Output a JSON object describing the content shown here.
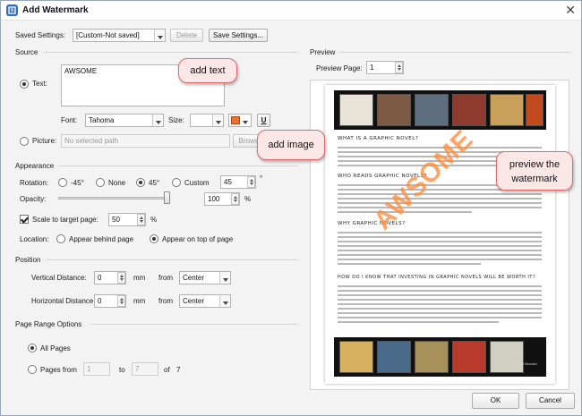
{
  "window": {
    "title": "Add Watermark"
  },
  "saved_settings": {
    "label": "Saved Settings:",
    "value": "[Custom-Not saved]",
    "delete_label": "Delete",
    "save_label": "Save Settings..."
  },
  "source": {
    "heading": "Source",
    "text_label": "Text:",
    "text_value": "AWSOME",
    "font_label": "Font:",
    "font_value": "Tahoma",
    "size_label": "Size:",
    "size_value": "",
    "underline_label": "U",
    "color_swatch": "#f07030",
    "picture_label": "Picture:",
    "picture_placeholder": "No selected path",
    "browse_label": "Browse"
  },
  "appearance": {
    "heading": "Appearance",
    "rotation_label": "Rotation:",
    "rot_neg45": "-45°",
    "rot_none": "None",
    "rot_45": "45°",
    "rot_custom": "Custom",
    "rot_custom_value": "45",
    "rot_unit": "°",
    "opacity_label": "Opacity:",
    "opacity_value": "100",
    "opacity_unit": "%",
    "opacity_fraction": 1.0,
    "scale_label": "Scale to target page:",
    "scale_value": "50",
    "scale_unit": "%",
    "location_label": "Location:",
    "behind_label": "Appear behind page",
    "ontop_label": "Appear on top of page"
  },
  "position": {
    "heading": "Position",
    "vert_label": "Vertical Distance:",
    "vert_value": "0",
    "vert_unit": "mm",
    "vert_from": "from",
    "vert_anchor": "Center",
    "horiz_label": "Horizontal Distance:",
    "horiz_value": "0",
    "horiz_unit": "mm",
    "horiz_from": "from",
    "horiz_anchor": "Center"
  },
  "page_range": {
    "heading": "Page Range Options",
    "all_label": "All Pages",
    "from_label": "Pages from",
    "from_value": "1",
    "to_label": "to",
    "to_value": "7",
    "of_label": "of",
    "total": "7"
  },
  "preview": {
    "heading": "Preview",
    "page_label": "Preview Page:",
    "page_value": "1",
    "watermark_text": "AWSOME",
    "headings": [
      "WHAT IS A GRAPHIC NOVEL?",
      "WHO READS GRAPHIC NOVELS?",
      "WHY GRAPHIC NOVELS?",
      "HOW DO I KNOW THAT INVESTING IN GRAPHIC NOVELS WILL BE WORTH IT?"
    ],
    "band_caption": "First Second"
  },
  "callouts": {
    "add_text": "add text",
    "add_image": "add image",
    "preview": "preview the watermark"
  },
  "footer": {
    "ok_label": "OK",
    "cancel_label": "Cancel"
  }
}
